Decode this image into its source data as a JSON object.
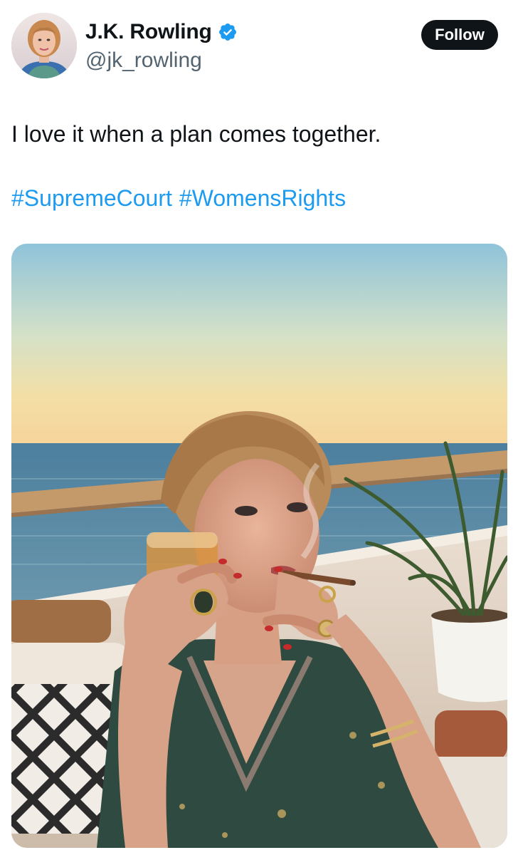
{
  "author": {
    "display_name": "J.K. Rowling",
    "handle": "@jk_rowling",
    "verified": true,
    "verified_icon": "verified-badge-icon",
    "avatar": "profile-avatar"
  },
  "follow_label": "Follow",
  "tweet": {
    "text": "I love it when a plan comes together.",
    "hashtags": [
      "#SupremeCourt",
      "#WomensRights"
    ]
  },
  "media": {
    "type": "photo",
    "description_icon": "photo"
  },
  "colors": {
    "text_primary": "#0f1419",
    "text_secondary": "#536471",
    "link": "#1d9bf0",
    "follow_bg": "#0f1419",
    "verified": "#1d9bf0"
  }
}
